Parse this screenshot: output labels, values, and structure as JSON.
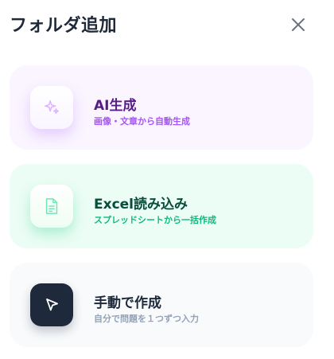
{
  "dialog": {
    "title": "フォルダ追加",
    "close_icon": "close-icon"
  },
  "options": [
    {
      "title": "AI生成",
      "subtitle": "画像・文章から自動生成",
      "icon": "sparkles-icon",
      "accent": "#581c87",
      "sub_color": "#a855f7",
      "bg": "#faf5ff"
    },
    {
      "title": "Excel読み込み",
      "subtitle": "スプレッドシートから一括作成",
      "icon": "file-icon",
      "accent": "#064e3b",
      "sub_color": "#10b981",
      "bg": "#ecfdf5"
    },
    {
      "title": "手動で作成",
      "subtitle": "自分で問題を１つずつ入力",
      "icon": "cursor-icon",
      "accent": "#1e293b",
      "sub_color": "#94a3b8",
      "bg": "#f8fafc"
    }
  ]
}
